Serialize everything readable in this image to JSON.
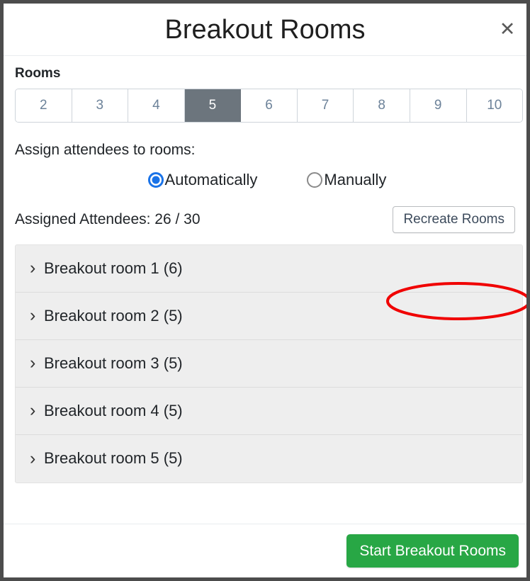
{
  "dialog": {
    "title": "Breakout Rooms",
    "close_icon": "close-icon",
    "close_glyph": "✕"
  },
  "rooms_section": {
    "label": "Rooms",
    "counts": [
      "2",
      "3",
      "4",
      "5",
      "6",
      "7",
      "8",
      "9",
      "10"
    ],
    "selected_count": "5",
    "selected_index": 3,
    "selected_bg": "#6c757d",
    "inactive_text_color": "#6c8299"
  },
  "assign": {
    "label": "Assign attendees to rooms:",
    "options": [
      {
        "label": "Automatically",
        "checked": true
      },
      {
        "label": "Manually",
        "checked": false
      }
    ],
    "accent_color": "#1a73e8"
  },
  "attendees": {
    "text": "Assigned Attendees: 26 / 30",
    "assigned": 26,
    "total": 30,
    "recreate_label": "Recreate Rooms"
  },
  "rooms_list": [
    {
      "chevron": "›",
      "name": "Breakout room 1 (6)",
      "count": 6
    },
    {
      "chevron": "›",
      "name": "Breakout room 2 (5)",
      "count": 5
    },
    {
      "chevron": "›",
      "name": "Breakout room 3 (5)",
      "count": 5
    },
    {
      "chevron": "›",
      "name": "Breakout room 4 (5)",
      "count": 5
    },
    {
      "chevron": "›",
      "name": "Breakout room 5 (5)",
      "count": 5
    }
  ],
  "footer": {
    "start_label": "Start Breakout Rooms",
    "start_color": "#28a745"
  },
  "annotation": {
    "shape": "ellipse",
    "color": "#f00000",
    "target": "Recreate Rooms"
  }
}
